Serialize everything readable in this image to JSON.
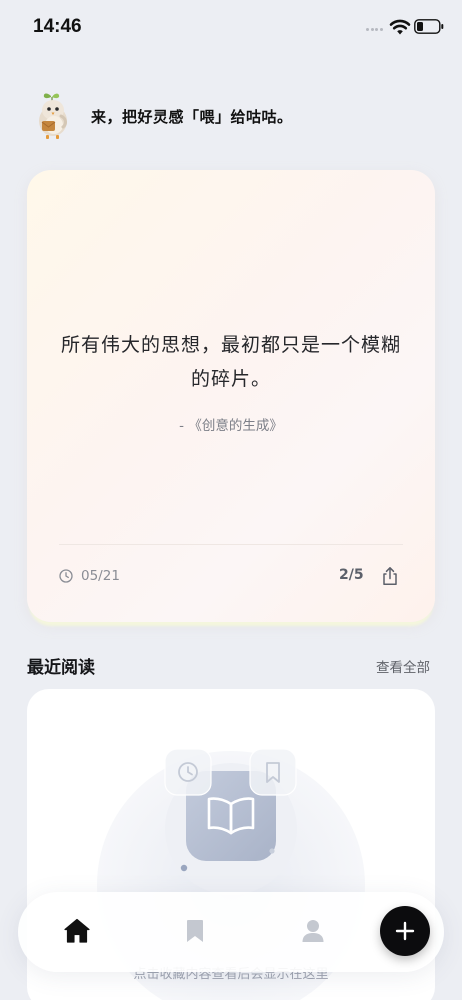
{
  "status_bar": {
    "time": "14:46",
    "icons": [
      "signal-dots-icon",
      "wifi-icon",
      "battery-icon"
    ]
  },
  "greeting": {
    "mascot": "bird-mascot",
    "text": "来，把好灵感「喂」给咕咕。"
  },
  "quote_card": {
    "text": "所有伟大的思想，最初都只是一个模糊的碎片。",
    "source": "- 《创意的生成》",
    "date": "05/21",
    "page": "2/5",
    "icons": [
      "clock-icon",
      "share-icon"
    ]
  },
  "recent_reading": {
    "title": "最近阅读",
    "view_all": "查看全部",
    "empty_hint": "点击收藏内容查看后会显示在这里",
    "icons": [
      "book-icon",
      "clock-icon",
      "bookmark-icon"
    ]
  },
  "tab_bar": {
    "tabs": [
      {
        "icon": "home-icon",
        "active": true
      },
      {
        "icon": "bookmark-icon",
        "active": false
      },
      {
        "icon": "profile-icon",
        "active": false
      }
    ],
    "fab_icon": "plus-icon"
  },
  "colors": {
    "background": "#eceef3",
    "accent_dark": "#0c0c0e",
    "muted_text": "#8a8d95",
    "card_gradient_start": "#fff8ea",
    "card_gradient_end": "#fef2ec"
  }
}
